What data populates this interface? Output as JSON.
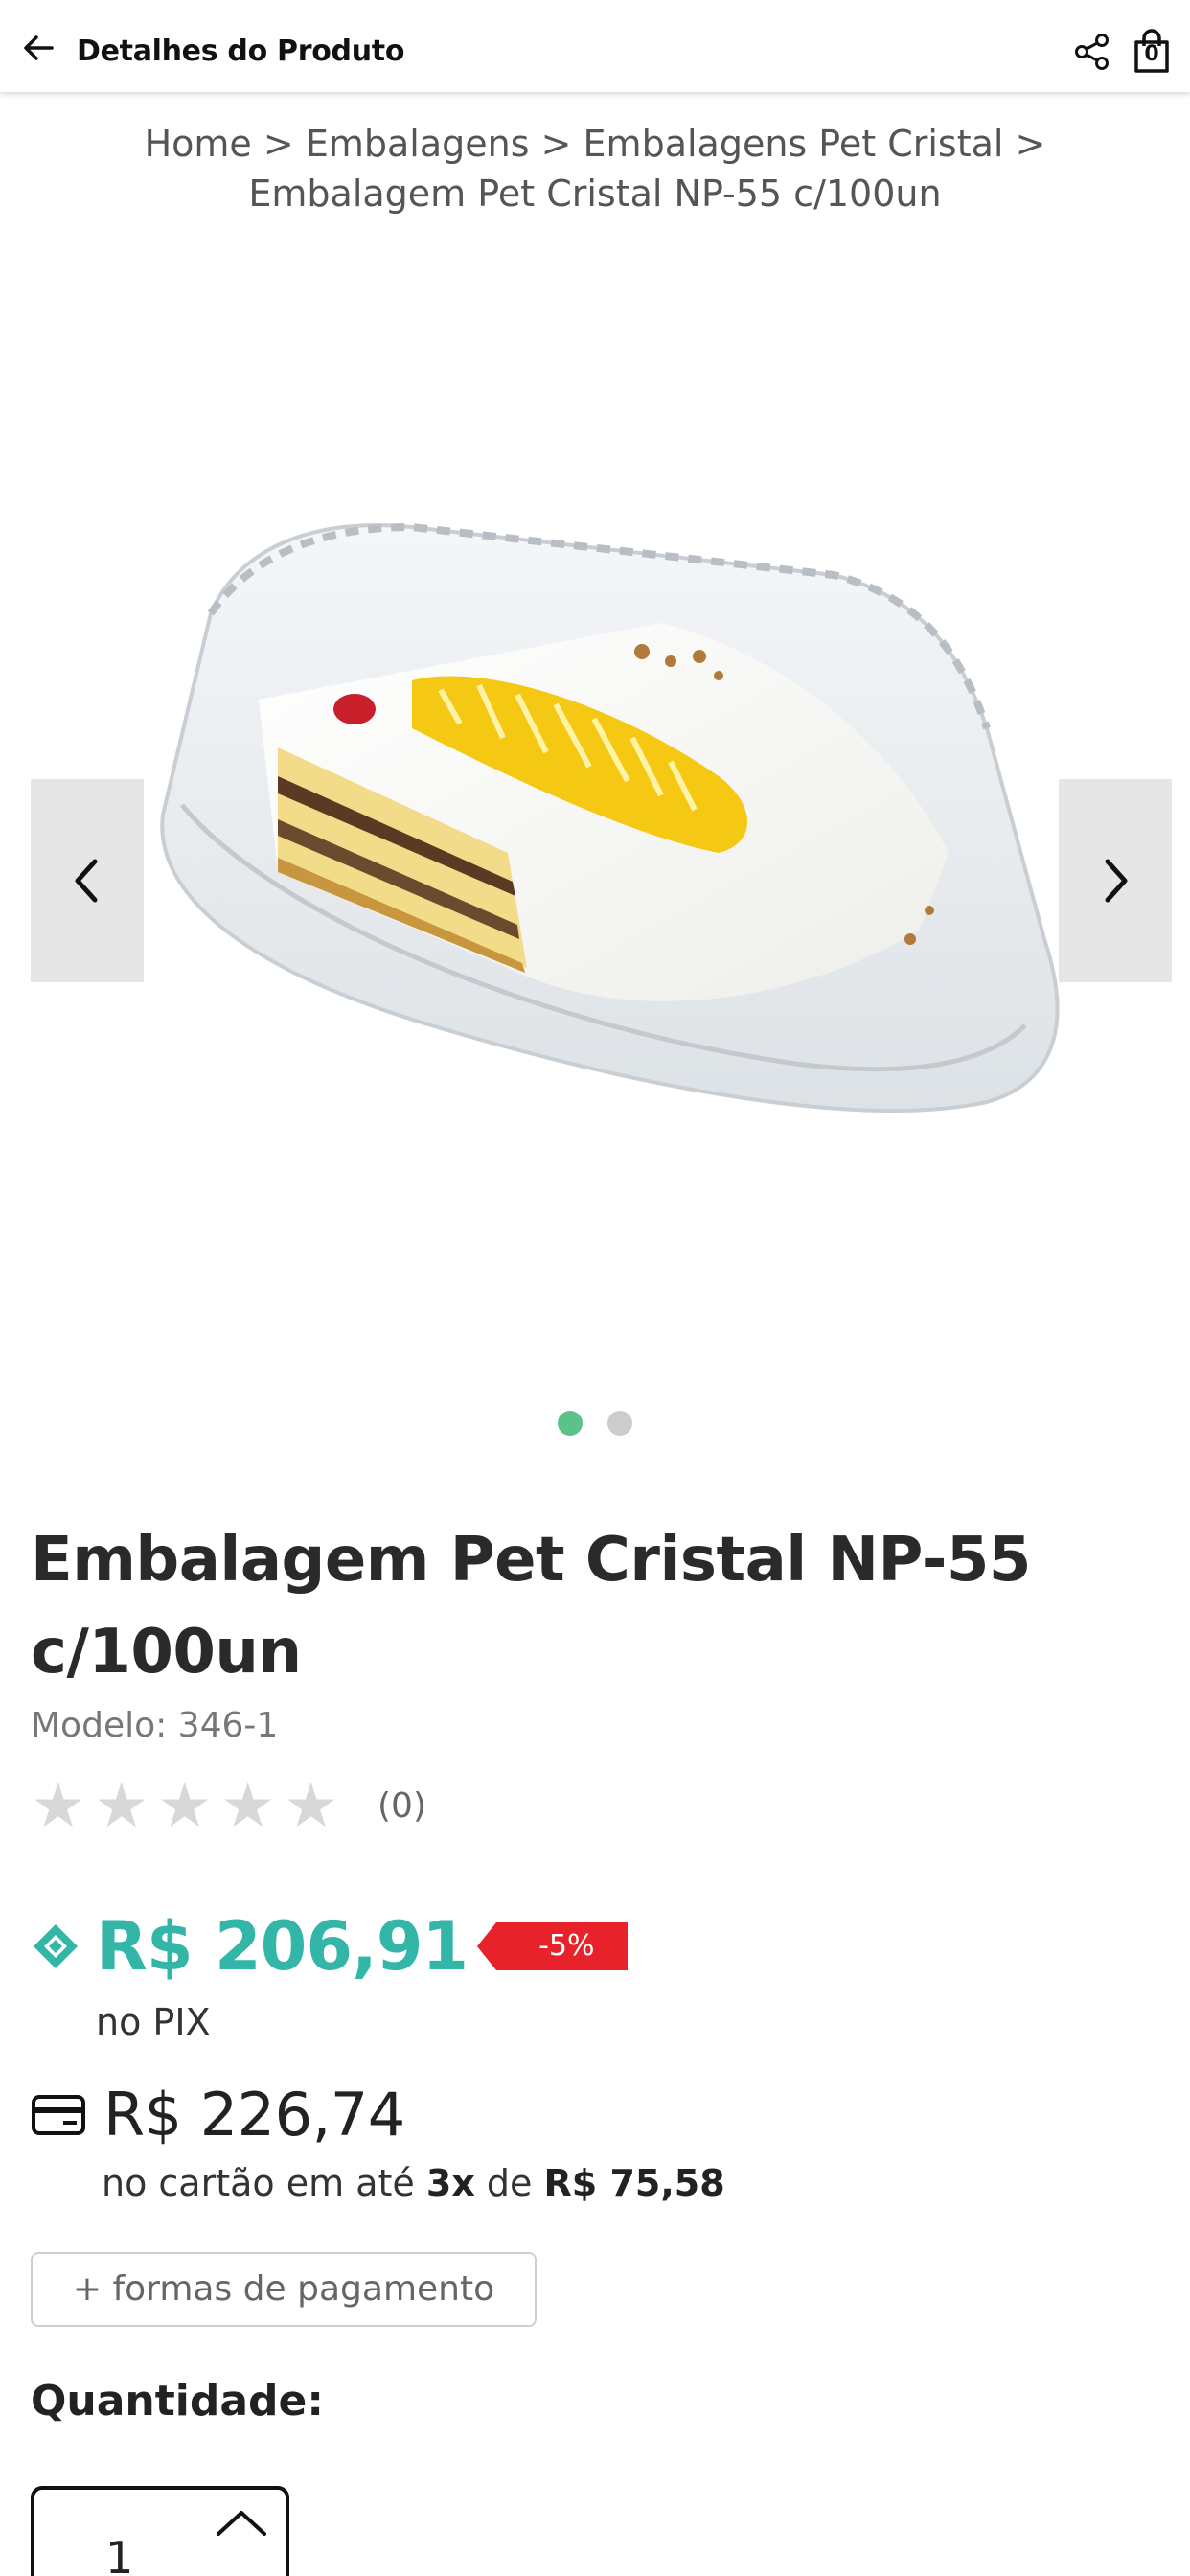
{
  "header": {
    "title": "Detalhes do Produto",
    "back_icon": "arrow-left-icon",
    "share_icon": "share-icon",
    "bag_icon": "shopping-bag-icon",
    "bag_count": "0"
  },
  "breadcrumb": {
    "items": [
      "Home",
      "Embalagens",
      "Embalagens Pet Cristal",
      "Embalagem Pet Cristal NP-55 c/100un"
    ],
    "separator": ">"
  },
  "carousel": {
    "prev_icon": "chevron-left-icon",
    "next_icon": "chevron-right-icon",
    "dots_total": 2,
    "active_dot": 1
  },
  "product": {
    "title": "Embalagem Pet Cristal NP-55 c/100un",
    "model": "Modelo: 346-1",
    "rating_stars": 0,
    "rating_max": 5,
    "rating_count": "(0)"
  },
  "pricing": {
    "pix_price": "R$ 206,91",
    "pix_label": "no PIX",
    "discount_badge": "-5%",
    "card_price": "R$ 226,74",
    "card_prefix": "no cartão em até",
    "card_installments": "3x",
    "card_middle": "de",
    "card_installment_value": "R$ 75,58",
    "payment_options_button": "+ formas de pagamento",
    "colors": {
      "pix": "#33b6a8",
      "discount": "#e8222a",
      "active_dot": "#5cc28a"
    }
  },
  "quantity": {
    "label": "Quantidade:",
    "value": "1",
    "up_icon": "chevron-up-icon"
  }
}
